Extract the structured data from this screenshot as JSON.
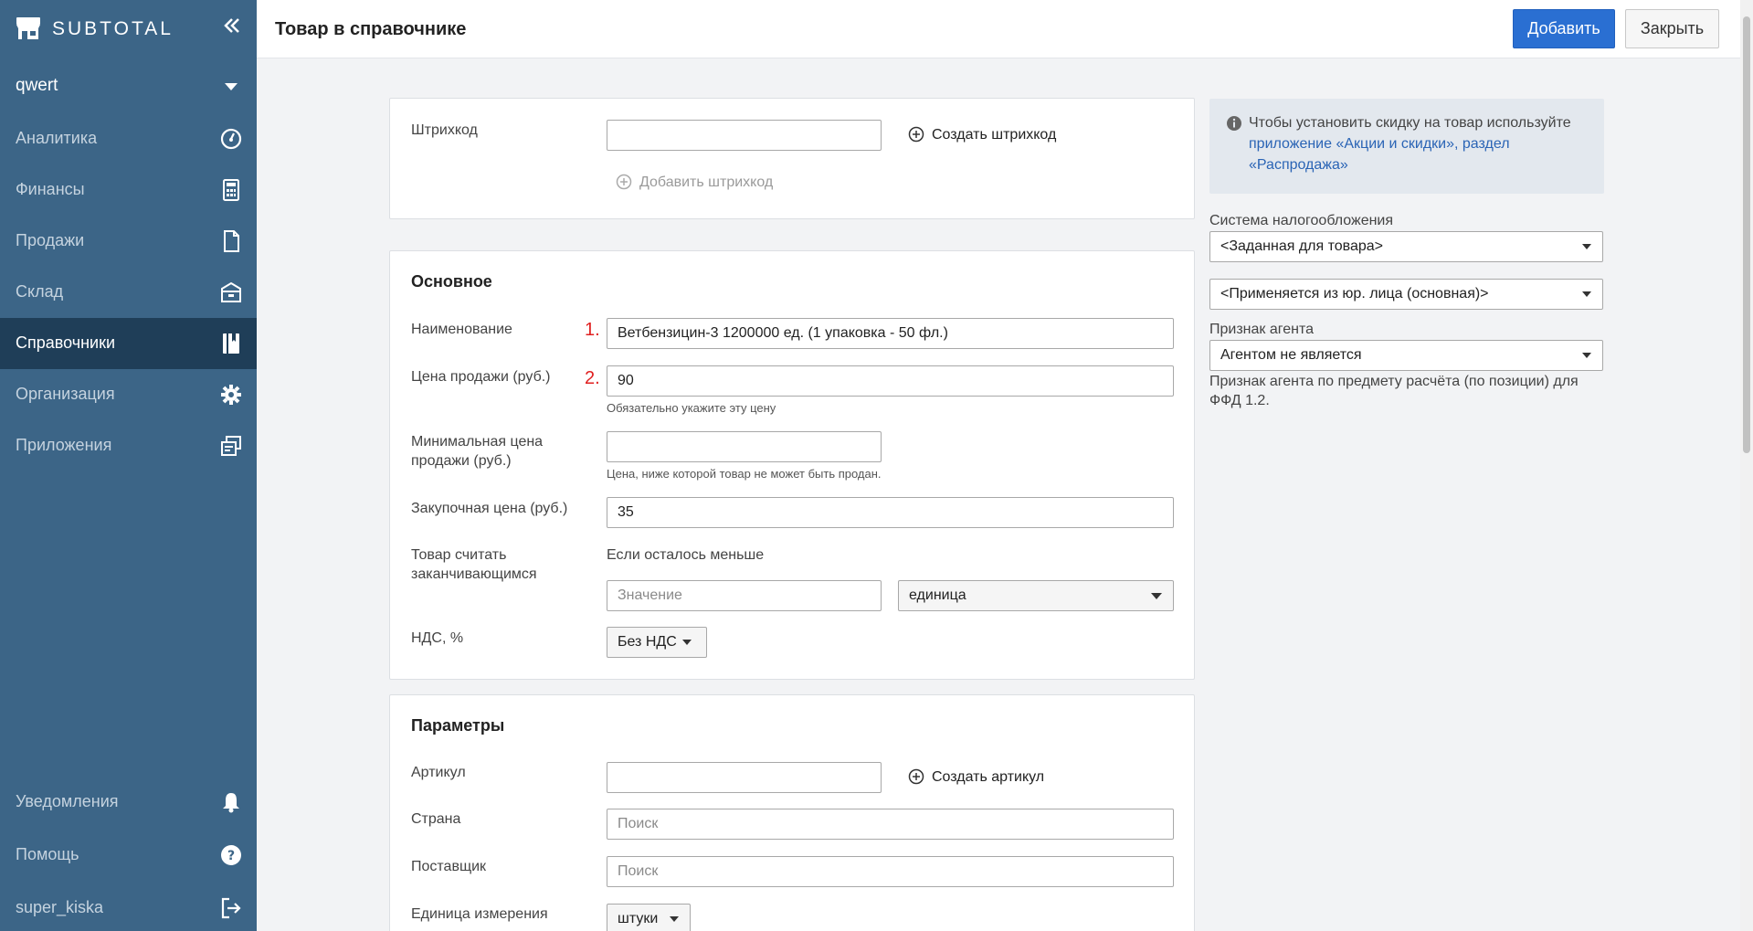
{
  "sidebar": {
    "logo_text": "SUBTOTAL",
    "org_name": "qwert",
    "items": [
      {
        "label": "Аналитика",
        "icon": "dashboard-gauge-icon"
      },
      {
        "label": "Финансы",
        "icon": "calculator-icon"
      },
      {
        "label": "Продажи",
        "icon": "document-icon"
      },
      {
        "label": "Склад",
        "icon": "warehouse-box-icon"
      },
      {
        "label": "Справочники",
        "icon": "book-icon",
        "active": true
      },
      {
        "label": "Организация",
        "icon": "gear-icon"
      },
      {
        "label": "Приложения",
        "icon": "apps-windows-icon"
      }
    ],
    "bottom_items": [
      {
        "label": "Уведомления",
        "icon": "bell-icon"
      },
      {
        "label": "Помощь",
        "icon": "help-icon"
      },
      {
        "label": "super_kiska",
        "icon": "logout-icon"
      }
    ]
  },
  "header": {
    "title": "Товар в справочнике",
    "add_label": "Добавить",
    "close_label": "Закрыть"
  },
  "barcode_card": {
    "label": "Штрихкод",
    "value": "",
    "create_label": "Создать штрихкод",
    "add_label": "Добавить штрихкод"
  },
  "main_card": {
    "title": "Основное",
    "name_label": "Наименование",
    "name_marker": "1.",
    "name_value": "Ветбензицин-3 1200000 ед. (1 упаковка - 50 фл.)",
    "price_label": "Цена продажи (руб.)",
    "price_marker": "2.",
    "price_value": "90",
    "price_hint": "Обязательно укажите эту цену",
    "min_price_label": "Минимальная цена продажи (руб.)",
    "min_price_value": "",
    "min_price_hint": "Цена, ниже которой товар не может быть продан.",
    "purchase_label": "Закупочная цена (руб.)",
    "purchase_value": "35",
    "low_stock_label": "Товар считать заканчивающимся",
    "low_stock_caption": "Если осталось меньше",
    "low_stock_placeholder": "Значение",
    "low_stock_unit": "единица",
    "vat_label": "НДС, %",
    "vat_value": "Без НДС"
  },
  "params_card": {
    "title": "Параметры",
    "article_label": "Артикул",
    "article_value": "",
    "create_article_label": "Создать артикул",
    "country_label": "Страна",
    "country_placeholder": "Поиск",
    "supplier_label": "Поставщик",
    "supplier_placeholder": "Поиск",
    "unit_label": "Единица измерения",
    "unit_value": "штуки"
  },
  "right_panel": {
    "info_text": "Чтобы установить скидку на товар используйте ",
    "info_link": "приложение «Акции и скидки», раздел «Распродажа»",
    "tax_label": "Система налогообложения",
    "tax_value": "<Заданная для товара>",
    "entity_value": "<Применяется из юр. лица (основная)>",
    "agent_label": "Признак агента",
    "agent_value": "Агентом не является",
    "agent_hint": "Признак агента по предмету расчёта (по позиции) для ФФД 1.2."
  },
  "colors": {
    "sidebar_bg": "#3c6587",
    "sidebar_active": "#1f3e58",
    "primary": "#2a6fd2",
    "marker": "#e02020"
  }
}
